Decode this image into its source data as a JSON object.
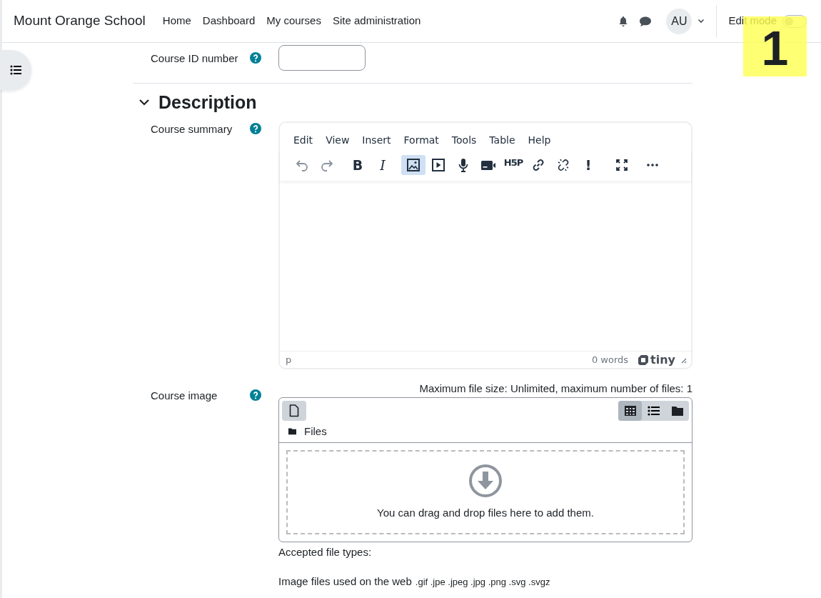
{
  "navbar": {
    "brand": "Mount Orange School",
    "links": [
      {
        "label": "Home"
      },
      {
        "label": "Dashboard"
      },
      {
        "label": "My courses"
      },
      {
        "label": "Site administration"
      }
    ],
    "avatar": "AU",
    "edit_mode": {
      "label": "Edit mode",
      "on": false
    }
  },
  "callout": {
    "label": "1"
  },
  "id_field": {
    "label": "Course ID number"
  },
  "section": {
    "title": "Description",
    "expanded": true
  },
  "summary": {
    "label": "Course summary",
    "menu": [
      "Edit",
      "View",
      "Insert",
      "Format",
      "Tools",
      "Table",
      "Help"
    ],
    "toolbar": [
      {
        "kind": "undo",
        "disabled": true,
        "selected": false
      },
      {
        "kind": "redo",
        "disabled": true,
        "selected": false
      },
      {
        "kind": "bold",
        "glyph": "B",
        "disabled": false,
        "selected": false
      },
      {
        "kind": "italic",
        "glyph": "I",
        "disabled": false,
        "selected": false
      },
      {
        "kind": "image",
        "disabled": false,
        "selected": true
      },
      {
        "kind": "media",
        "disabled": false,
        "selected": false
      },
      {
        "kind": "mic",
        "disabled": false,
        "selected": false
      },
      {
        "kind": "video",
        "disabled": false,
        "selected": false
      },
      {
        "kind": "h5p",
        "glyph": "H5P",
        "disabled": false,
        "selected": false
      },
      {
        "kind": "link",
        "disabled": false,
        "selected": false
      },
      {
        "kind": "unlink",
        "disabled": false,
        "selected": false
      },
      {
        "kind": "exclaim",
        "glyph": "!",
        "disabled": false,
        "selected": false
      },
      {
        "kind": "fullscreen",
        "disabled": false,
        "selected": false
      },
      {
        "kind": "more",
        "disabled": false,
        "selected": false
      }
    ],
    "status_path": "p",
    "word_count": "0 words",
    "brand": "tiny"
  },
  "image": {
    "label": "Course image",
    "limits": "Maximum file size: Unlimited, maximum number of files: 1",
    "views": [
      {
        "kind": "grid",
        "selected": true
      },
      {
        "kind": "list",
        "selected": false
      },
      {
        "kind": "tree",
        "selected": false
      }
    ],
    "path": "Files",
    "drop_text": "You can drag and drop files here to add them.",
    "accepted_label": "Accepted file types:",
    "types": [
      {
        "name": "Image files used on the web",
        "extensions": ".gif .jpe .jpeg .jpg .png .svg .svgz"
      }
    ]
  }
}
